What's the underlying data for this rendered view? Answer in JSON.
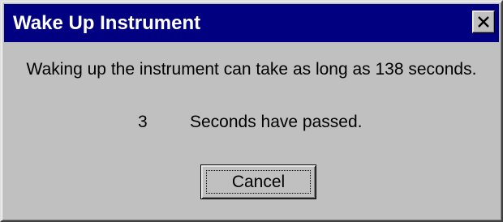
{
  "window": {
    "title": "Wake Up Instrument",
    "close_icon": "close-icon"
  },
  "content": {
    "message": "Waking up the instrument can take as long as 138 seconds.",
    "elapsed_value": "3",
    "elapsed_label": "Seconds have passed."
  },
  "buttons": {
    "cancel_label": "Cancel"
  },
  "colors": {
    "titlebar": "#000080",
    "dialog_face": "#c0c0c0",
    "title_text": "#ffffff"
  }
}
